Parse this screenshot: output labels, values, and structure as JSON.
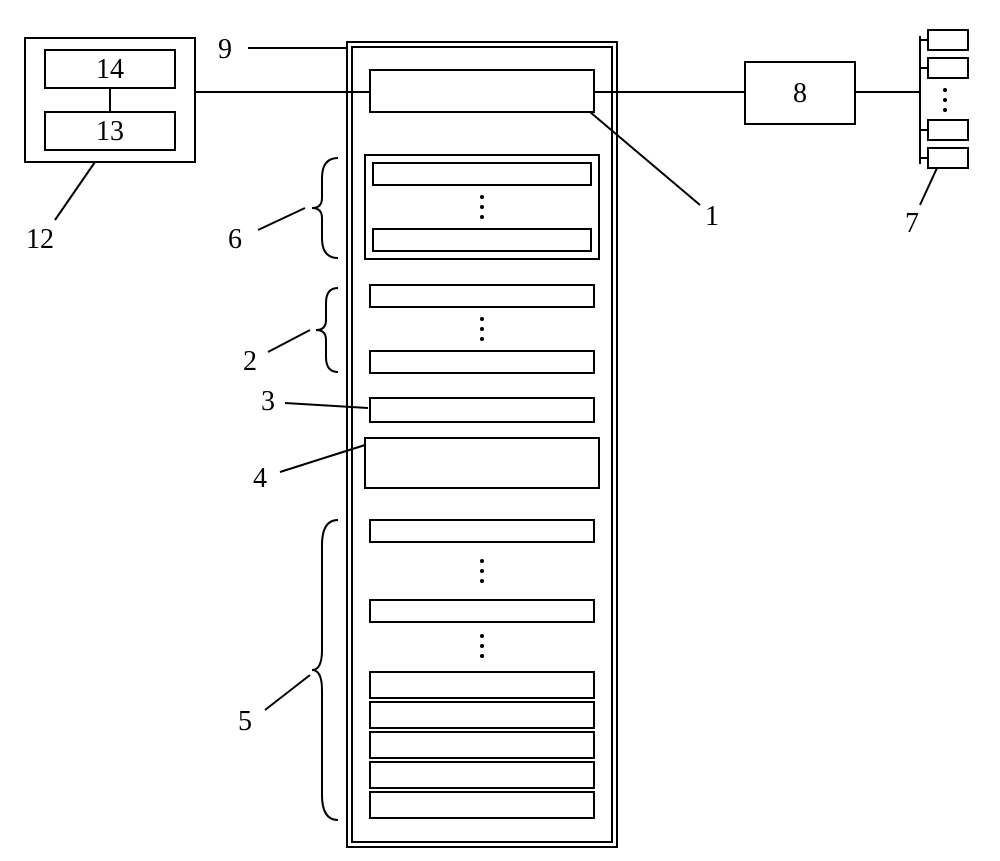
{
  "labels": {
    "l1": "1",
    "l2": "2",
    "l3": "3",
    "l4": "4",
    "l5": "5",
    "l6": "6",
    "l7": "7",
    "l8": "8",
    "l9": "9",
    "l12": "12",
    "l13": "13",
    "l14": "14"
  }
}
